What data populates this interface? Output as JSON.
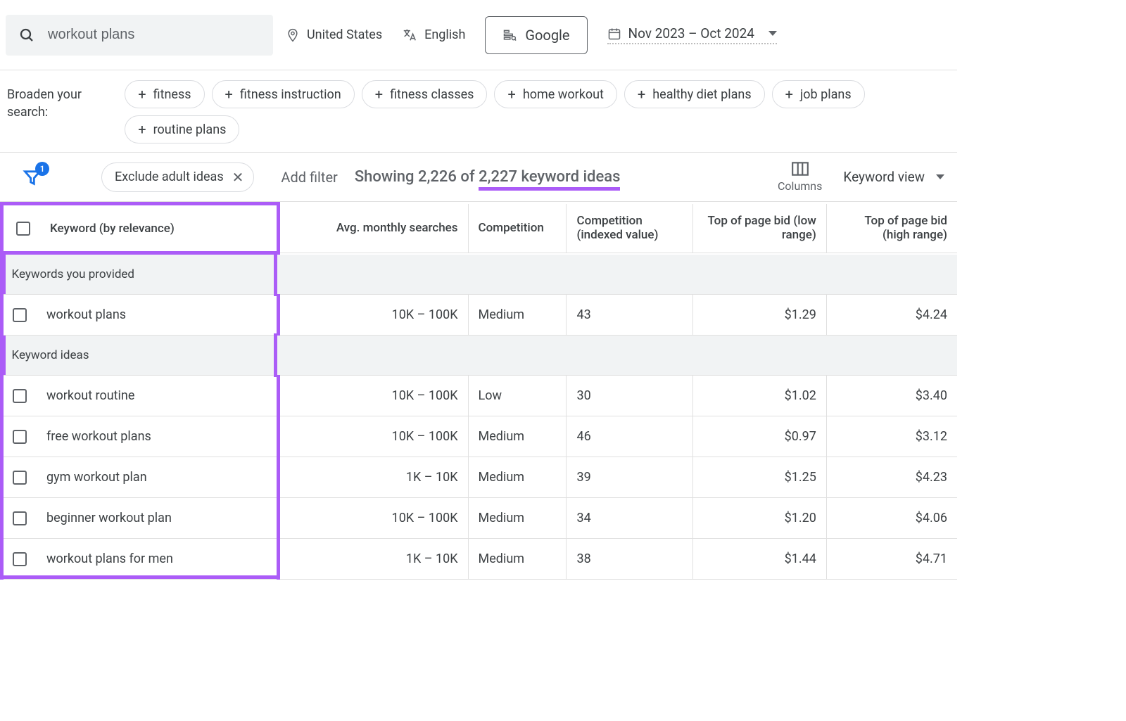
{
  "search": {
    "value": "workout plans"
  },
  "location": "United States",
  "language": "English",
  "network": "Google",
  "date_range": "Nov 2023 – Oct 2024",
  "broaden": {
    "label": "Broaden your search:",
    "chips": [
      "fitness",
      "fitness instruction",
      "fitness classes",
      "home workout",
      "healthy diet plans",
      "job plans",
      "routine plans"
    ]
  },
  "filter": {
    "badge": "1",
    "exclude_adult": "Exclude adult ideas",
    "add_filter": "Add filter"
  },
  "showing": {
    "prefix": "Showing 2,226 of ",
    "highlight": "2,227 keyword ideas"
  },
  "columns_label": "Columns",
  "keyword_view": "Keyword view",
  "headers": {
    "keyword": "Keyword (by relevance)",
    "searches": "Avg. monthly searches",
    "competition": "Competition",
    "comp_index": "Competition (indexed value)",
    "low_bid": "Top of page bid (low range)",
    "high_bid": "Top of page bid (high range)"
  },
  "sections": {
    "provided_label": "Keywords you provided",
    "ideas_label": "Keyword ideas"
  },
  "provided": [
    {
      "keyword": "workout plans",
      "searches": "10K – 100K",
      "competition": "Medium",
      "comp_index": "43",
      "low_bid": "$1.29",
      "high_bid": "$4.24"
    }
  ],
  "ideas": [
    {
      "keyword": "workout routine",
      "searches": "10K – 100K",
      "competition": "Low",
      "comp_index": "30",
      "low_bid": "$1.02",
      "high_bid": "$3.40"
    },
    {
      "keyword": "free workout plans",
      "searches": "10K – 100K",
      "competition": "Medium",
      "comp_index": "46",
      "low_bid": "$0.97",
      "high_bid": "$3.12"
    },
    {
      "keyword": "gym workout plan",
      "searches": "1K – 10K",
      "competition": "Medium",
      "comp_index": "39",
      "low_bid": "$1.25",
      "high_bid": "$4.23"
    },
    {
      "keyword": "beginner workout plan",
      "searches": "10K – 100K",
      "competition": "Medium",
      "comp_index": "34",
      "low_bid": "$1.20",
      "high_bid": "$4.06"
    },
    {
      "keyword": "workout plans for men",
      "searches": "1K – 10K",
      "competition": "Medium",
      "comp_index": "38",
      "low_bid": "$1.44",
      "high_bid": "$4.71"
    }
  ]
}
